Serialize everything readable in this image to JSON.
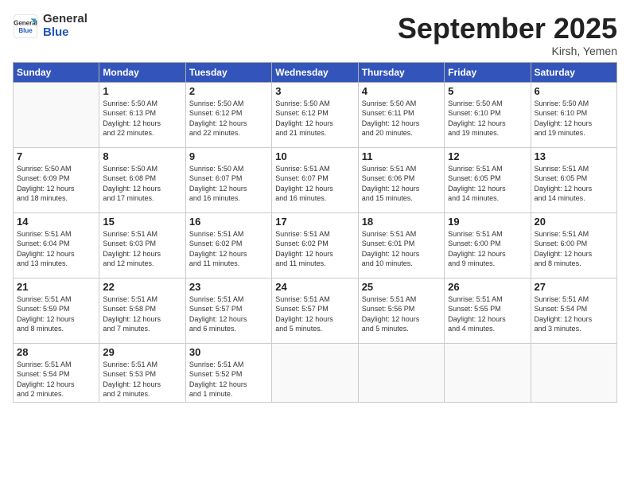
{
  "header": {
    "logo_general": "General",
    "logo_blue": "Blue",
    "month_title": "September 2025",
    "location": "Kirsh, Yemen"
  },
  "days_of_week": [
    "Sunday",
    "Monday",
    "Tuesday",
    "Wednesday",
    "Thursday",
    "Friday",
    "Saturday"
  ],
  "weeks": [
    [
      {
        "day": "",
        "info": ""
      },
      {
        "day": "1",
        "info": "Sunrise: 5:50 AM\nSunset: 6:13 PM\nDaylight: 12 hours\nand 22 minutes."
      },
      {
        "day": "2",
        "info": "Sunrise: 5:50 AM\nSunset: 6:12 PM\nDaylight: 12 hours\nand 22 minutes."
      },
      {
        "day": "3",
        "info": "Sunrise: 5:50 AM\nSunset: 6:12 PM\nDaylight: 12 hours\nand 21 minutes."
      },
      {
        "day": "4",
        "info": "Sunrise: 5:50 AM\nSunset: 6:11 PM\nDaylight: 12 hours\nand 20 minutes."
      },
      {
        "day": "5",
        "info": "Sunrise: 5:50 AM\nSunset: 6:10 PM\nDaylight: 12 hours\nand 19 minutes."
      },
      {
        "day": "6",
        "info": "Sunrise: 5:50 AM\nSunset: 6:10 PM\nDaylight: 12 hours\nand 19 minutes."
      }
    ],
    [
      {
        "day": "7",
        "info": "Sunrise: 5:50 AM\nSunset: 6:09 PM\nDaylight: 12 hours\nand 18 minutes."
      },
      {
        "day": "8",
        "info": "Sunrise: 5:50 AM\nSunset: 6:08 PM\nDaylight: 12 hours\nand 17 minutes."
      },
      {
        "day": "9",
        "info": "Sunrise: 5:50 AM\nSunset: 6:07 PM\nDaylight: 12 hours\nand 16 minutes."
      },
      {
        "day": "10",
        "info": "Sunrise: 5:51 AM\nSunset: 6:07 PM\nDaylight: 12 hours\nand 16 minutes."
      },
      {
        "day": "11",
        "info": "Sunrise: 5:51 AM\nSunset: 6:06 PM\nDaylight: 12 hours\nand 15 minutes."
      },
      {
        "day": "12",
        "info": "Sunrise: 5:51 AM\nSunset: 6:05 PM\nDaylight: 12 hours\nand 14 minutes."
      },
      {
        "day": "13",
        "info": "Sunrise: 5:51 AM\nSunset: 6:05 PM\nDaylight: 12 hours\nand 14 minutes."
      }
    ],
    [
      {
        "day": "14",
        "info": "Sunrise: 5:51 AM\nSunset: 6:04 PM\nDaylight: 12 hours\nand 13 minutes."
      },
      {
        "day": "15",
        "info": "Sunrise: 5:51 AM\nSunset: 6:03 PM\nDaylight: 12 hours\nand 12 minutes."
      },
      {
        "day": "16",
        "info": "Sunrise: 5:51 AM\nSunset: 6:02 PM\nDaylight: 12 hours\nand 11 minutes."
      },
      {
        "day": "17",
        "info": "Sunrise: 5:51 AM\nSunset: 6:02 PM\nDaylight: 12 hours\nand 11 minutes."
      },
      {
        "day": "18",
        "info": "Sunrise: 5:51 AM\nSunset: 6:01 PM\nDaylight: 12 hours\nand 10 minutes."
      },
      {
        "day": "19",
        "info": "Sunrise: 5:51 AM\nSunset: 6:00 PM\nDaylight: 12 hours\nand 9 minutes."
      },
      {
        "day": "20",
        "info": "Sunrise: 5:51 AM\nSunset: 6:00 PM\nDaylight: 12 hours\nand 8 minutes."
      }
    ],
    [
      {
        "day": "21",
        "info": "Sunrise: 5:51 AM\nSunset: 5:59 PM\nDaylight: 12 hours\nand 8 minutes."
      },
      {
        "day": "22",
        "info": "Sunrise: 5:51 AM\nSunset: 5:58 PM\nDaylight: 12 hours\nand 7 minutes."
      },
      {
        "day": "23",
        "info": "Sunrise: 5:51 AM\nSunset: 5:57 PM\nDaylight: 12 hours\nand 6 minutes."
      },
      {
        "day": "24",
        "info": "Sunrise: 5:51 AM\nSunset: 5:57 PM\nDaylight: 12 hours\nand 5 minutes."
      },
      {
        "day": "25",
        "info": "Sunrise: 5:51 AM\nSunset: 5:56 PM\nDaylight: 12 hours\nand 5 minutes."
      },
      {
        "day": "26",
        "info": "Sunrise: 5:51 AM\nSunset: 5:55 PM\nDaylight: 12 hours\nand 4 minutes."
      },
      {
        "day": "27",
        "info": "Sunrise: 5:51 AM\nSunset: 5:54 PM\nDaylight: 12 hours\nand 3 minutes."
      }
    ],
    [
      {
        "day": "28",
        "info": "Sunrise: 5:51 AM\nSunset: 5:54 PM\nDaylight: 12 hours\nand 2 minutes."
      },
      {
        "day": "29",
        "info": "Sunrise: 5:51 AM\nSunset: 5:53 PM\nDaylight: 12 hours\nand 2 minutes."
      },
      {
        "day": "30",
        "info": "Sunrise: 5:51 AM\nSunset: 5:52 PM\nDaylight: 12 hours\nand 1 minute."
      },
      {
        "day": "",
        "info": ""
      },
      {
        "day": "",
        "info": ""
      },
      {
        "day": "",
        "info": ""
      },
      {
        "day": "",
        "info": ""
      }
    ]
  ]
}
